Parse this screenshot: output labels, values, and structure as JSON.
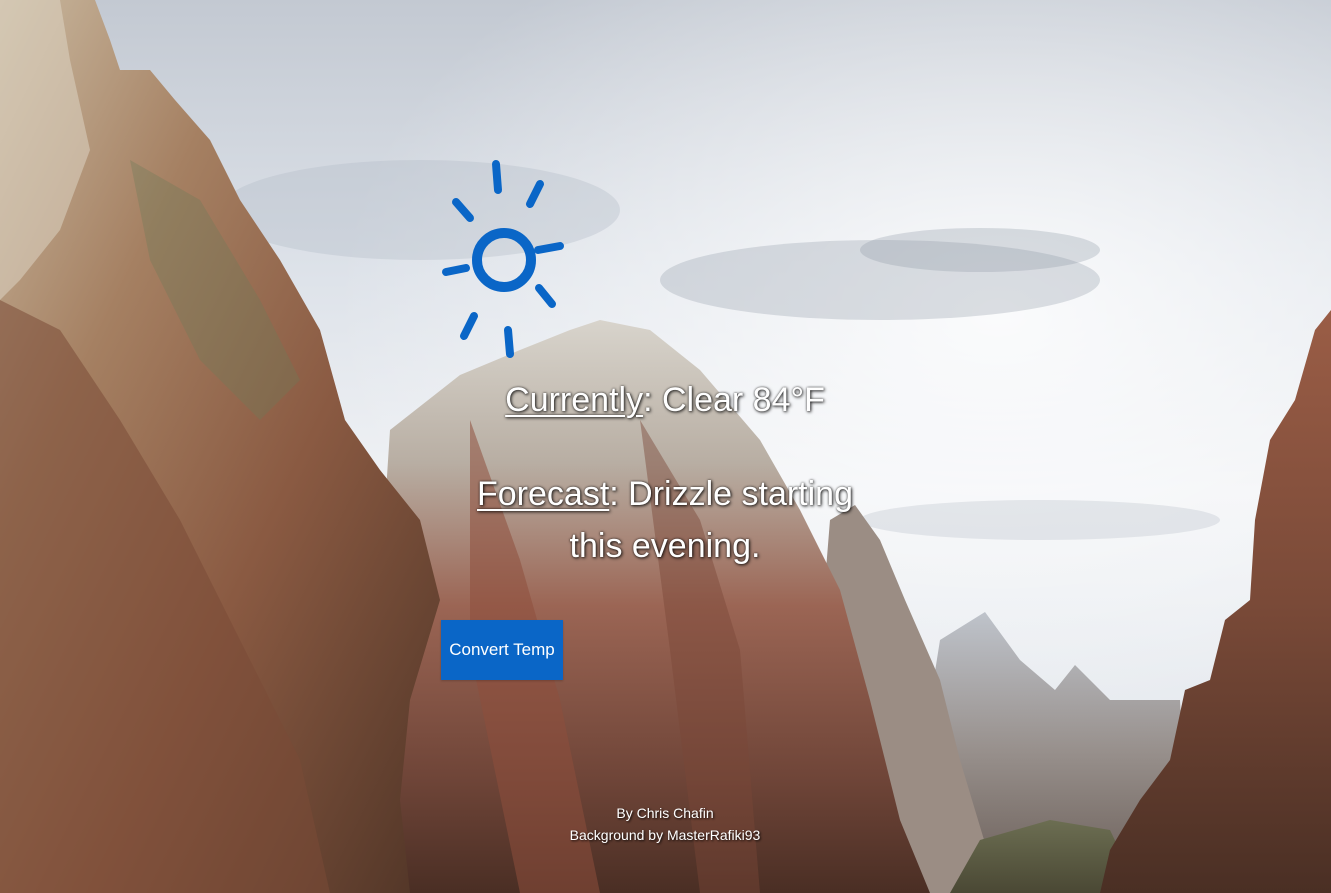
{
  "weather": {
    "icon": "sun-icon",
    "icon_color": "#0a66c7",
    "current_label": "Currently",
    "current_value": ": Clear 84°F",
    "forecast_label": "Forecast",
    "forecast_value": ": Drizzle starting this evening."
  },
  "actions": {
    "convert_label": "Convert Temp",
    "button_color": "#0a66c7"
  },
  "footer": {
    "author": "By Chris Chafin",
    "background_credit": "Background by MasterRafiki93"
  }
}
